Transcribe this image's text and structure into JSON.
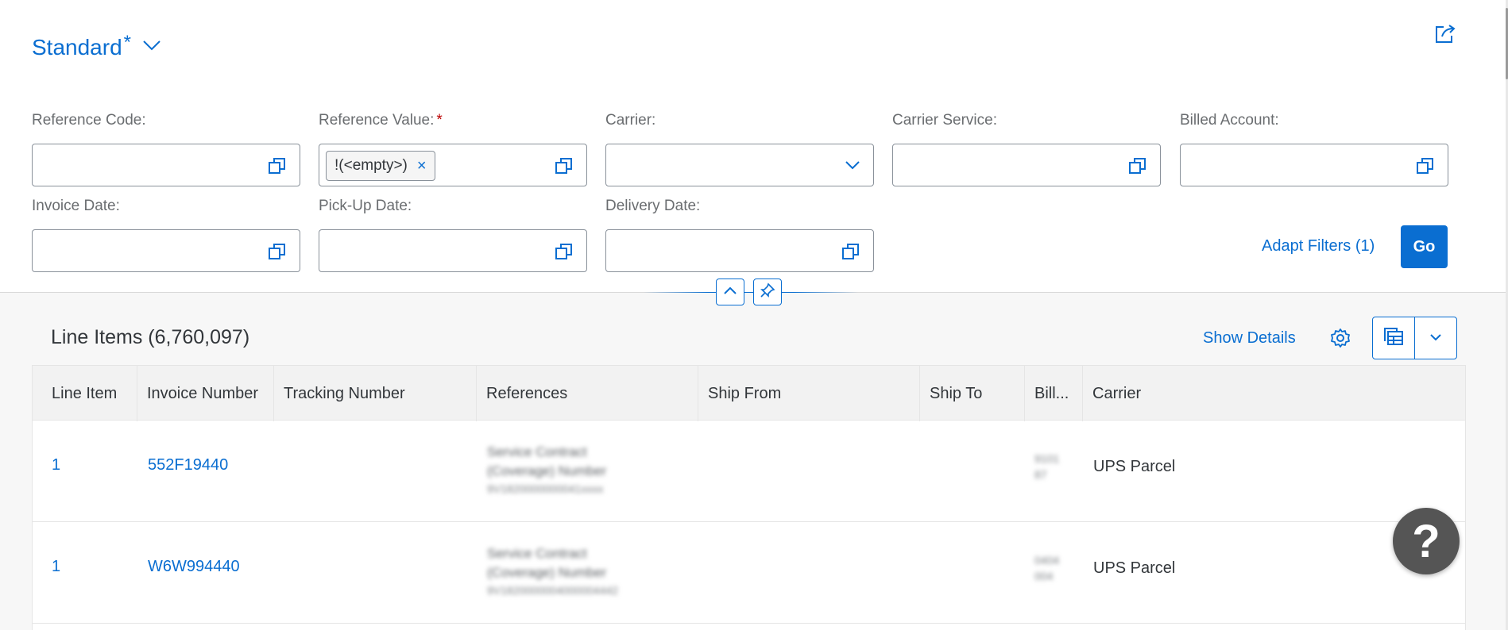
{
  "variant": {
    "title": "Standard",
    "modified_marker": "*"
  },
  "filters": {
    "reference_code": {
      "label": "Reference Code:",
      "value": ""
    },
    "reference_value": {
      "label": "Reference Value:",
      "required_marker": "*",
      "token": "!(<empty>)",
      "token_remove": "×"
    },
    "carrier": {
      "label": "Carrier:",
      "value": ""
    },
    "carrier_service": {
      "label": "Carrier Service:",
      "value": ""
    },
    "billed_account": {
      "label": "Billed Account:",
      "value": ""
    },
    "invoice_date": {
      "label": "Invoice Date:",
      "value": ""
    },
    "pickup_date": {
      "label": "Pick-Up Date:",
      "value": ""
    },
    "delivery_date": {
      "label": "Delivery Date:",
      "value": ""
    }
  },
  "actions": {
    "adapt_filters": "Adapt Filters (1)",
    "go": "Go"
  },
  "table": {
    "title": "Line Items (6,760,097)",
    "show_details": "Show Details",
    "columns": [
      "Line Item",
      "Invoice Number",
      "Tracking Number",
      "References",
      "Ship From",
      "Ship To",
      "Bill...",
      "Carrier"
    ],
    "rows": [
      {
        "line_item": "1",
        "invoice_number": "552F19440",
        "tracking_number": "",
        "references_line1": "Service Contract",
        "references_line2": "(Coverage) Number",
        "references_line3": "9V1820000000041xxxx",
        "ship_from": "",
        "ship_to": "",
        "billed_line1": "9101",
        "billed_line2": "87",
        "carrier": "UPS Parcel"
      },
      {
        "line_item": "1",
        "invoice_number": "W6W994440",
        "tracking_number": "",
        "references_line1": "Service Contract",
        "references_line2": "(Coverage) Number",
        "references_line3": "9V1820000004000004442",
        "ship_from": "",
        "ship_to": "",
        "billed_line1": "0404",
        "billed_line2": "004",
        "carrier": "UPS Parcel"
      }
    ]
  },
  "help": {
    "label": "?"
  },
  "colors": {
    "accent": "#0a6ed1",
    "required": "#bb0000",
    "help_bg": "#555555"
  },
  "icons": [
    "chevron-down-icon",
    "share-icon",
    "value-help-icon",
    "chevron-up-icon",
    "pin-icon",
    "gear-icon",
    "export-icon"
  ]
}
